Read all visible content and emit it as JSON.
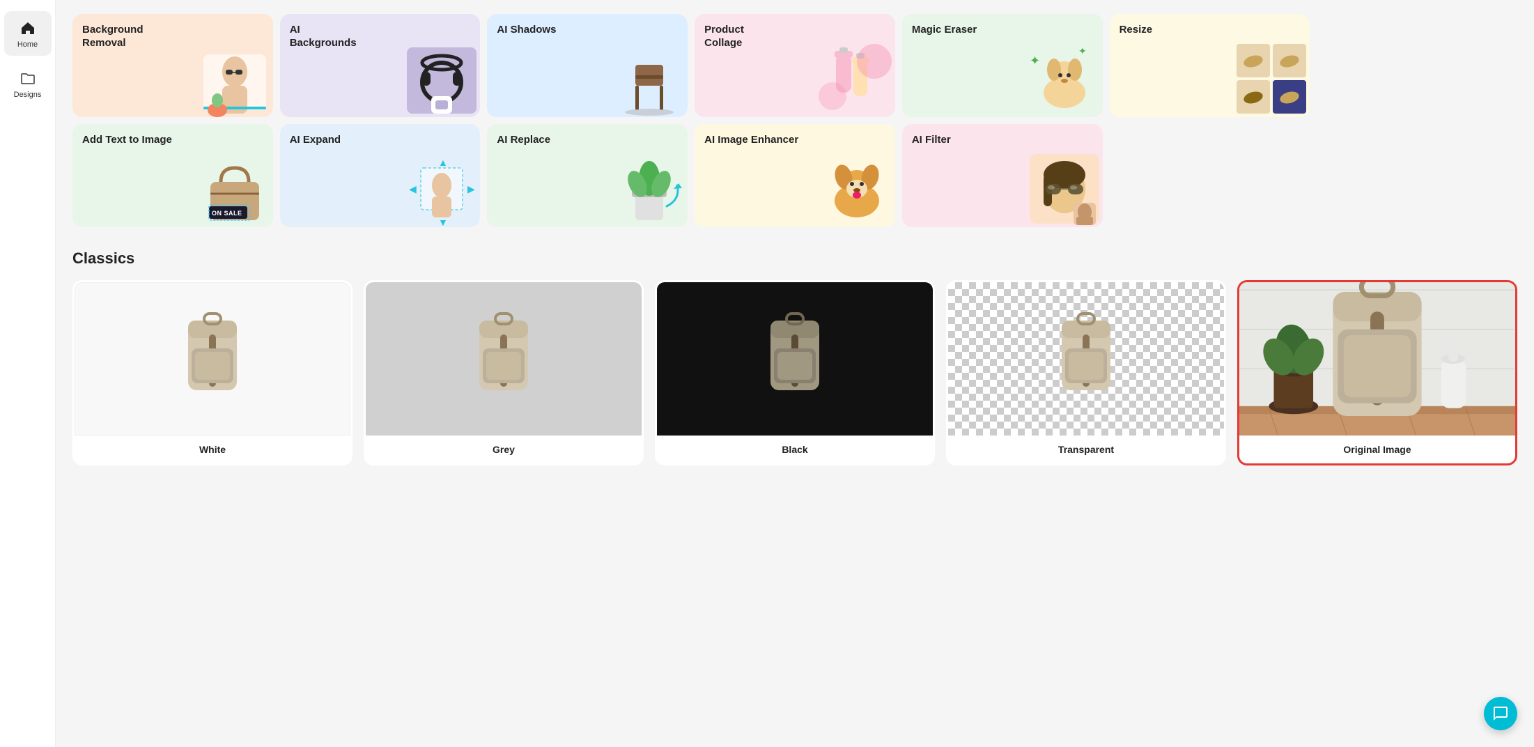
{
  "sidebar": {
    "items": [
      {
        "id": "home",
        "label": "Home",
        "icon": "home"
      },
      {
        "id": "designs",
        "label": "Designs",
        "icon": "folder"
      }
    ]
  },
  "tools": {
    "row1": [
      {
        "id": "bg-removal",
        "title": "Background Removal",
        "bg": "card-bg-removal",
        "color": "#fde8d8"
      },
      {
        "id": "ai-backgrounds",
        "title": "AI Backgrounds",
        "bg": "card-ai-backgrounds",
        "color": "#e8e4f5"
      },
      {
        "id": "ai-shadows",
        "title": "AI Shadows",
        "bg": "card-ai-shadows",
        "color": "#dceeff"
      },
      {
        "id": "product-collage",
        "title": "Product Collage",
        "bg": "card-product-collage",
        "color": "#fce4ec"
      },
      {
        "id": "magic-eraser",
        "title": "Magic Eraser",
        "bg": "card-magic-eraser",
        "color": "#e8f5e9"
      },
      {
        "id": "resize",
        "title": "Resize",
        "bg": "card-resize",
        "color": "#fdf9e3"
      }
    ],
    "row2": [
      {
        "id": "add-text",
        "title": "Add Text to Image",
        "bg": "card-add-text",
        "color": "#e8f5e9",
        "badge": "ON SALE"
      },
      {
        "id": "ai-expand",
        "title": "AI Expand",
        "bg": "card-ai-expand",
        "color": "#e3f0fb"
      },
      {
        "id": "ai-replace",
        "title": "AI Replace",
        "bg": "card-ai-replace",
        "color": "#e8f5e9"
      },
      {
        "id": "ai-image-enhancer",
        "title": "AI Image Enhancer",
        "bg": "card-ai-image-enhancer",
        "color": "#fff8e1"
      },
      {
        "id": "ai-filter",
        "title": "AI Filter",
        "bg": "card-ai-filter",
        "color": "#fce4ec"
      }
    ]
  },
  "classics": {
    "section_title": "Classics",
    "items": [
      {
        "id": "white",
        "label": "White",
        "bg_class": "white-bg",
        "selected": false
      },
      {
        "id": "grey",
        "label": "Grey",
        "bg_class": "grey-bg",
        "selected": false
      },
      {
        "id": "black",
        "label": "Black",
        "bg_class": "black-bg",
        "selected": false
      },
      {
        "id": "transparent",
        "label": "Transparent",
        "bg_class": "transparent-bg",
        "selected": false
      },
      {
        "id": "original",
        "label": "Original Image",
        "bg_class": "original-bg",
        "selected": true
      }
    ]
  }
}
